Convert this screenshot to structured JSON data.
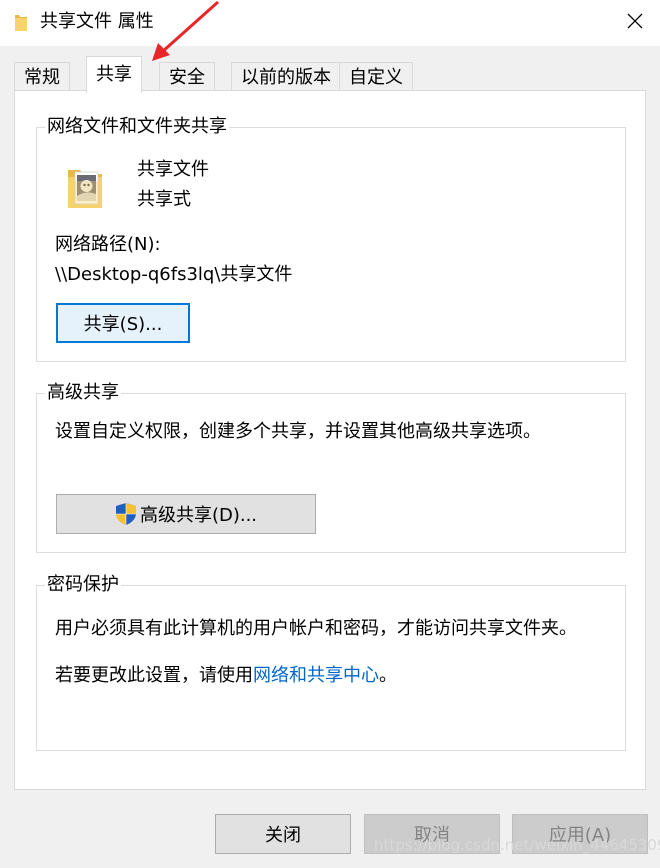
{
  "window": {
    "title": "共享文件 属性",
    "title_icon": "folder-icon",
    "close_icon": "close-icon"
  },
  "tabs": [
    {
      "label": "常规",
      "active": false
    },
    {
      "label": "共享",
      "active": true
    },
    {
      "label": "安全",
      "active": false
    },
    {
      "label": "以前的版本",
      "active": false
    },
    {
      "label": "自定义",
      "active": false
    }
  ],
  "network_sharing": {
    "title": "网络文件和文件夹共享",
    "folder_name": "共享文件",
    "share_status": "共享式",
    "path_label": "网络路径(N):",
    "path_value": "\\\\Desktop-q6fs3lq\\共享文件",
    "share_button": "共享(S)..."
  },
  "advanced_sharing": {
    "title": "高级共享",
    "description": "设置自定义权限，创建多个共享，并设置其他高级共享选项。",
    "button": "高级共享(D)...",
    "button_icon": "uac-shield-icon"
  },
  "password_protection": {
    "title": "密码保护",
    "line1": "用户必须具有此计算机的用户帐户和密码，才能访问共享文件夹。",
    "line2_prefix": "若要更改此设置，请使用",
    "line2_link": "网络和共享中心",
    "line2_suffix": "。"
  },
  "footer": {
    "close": "关闭",
    "cancel": "取消",
    "apply": "应用(A)"
  },
  "watermark": "https://blog.csdn.net/weixin_44645309",
  "colors": {
    "accent": "#0078d7",
    "link": "#0066cc",
    "annotation_arrow": "#e8262a"
  }
}
